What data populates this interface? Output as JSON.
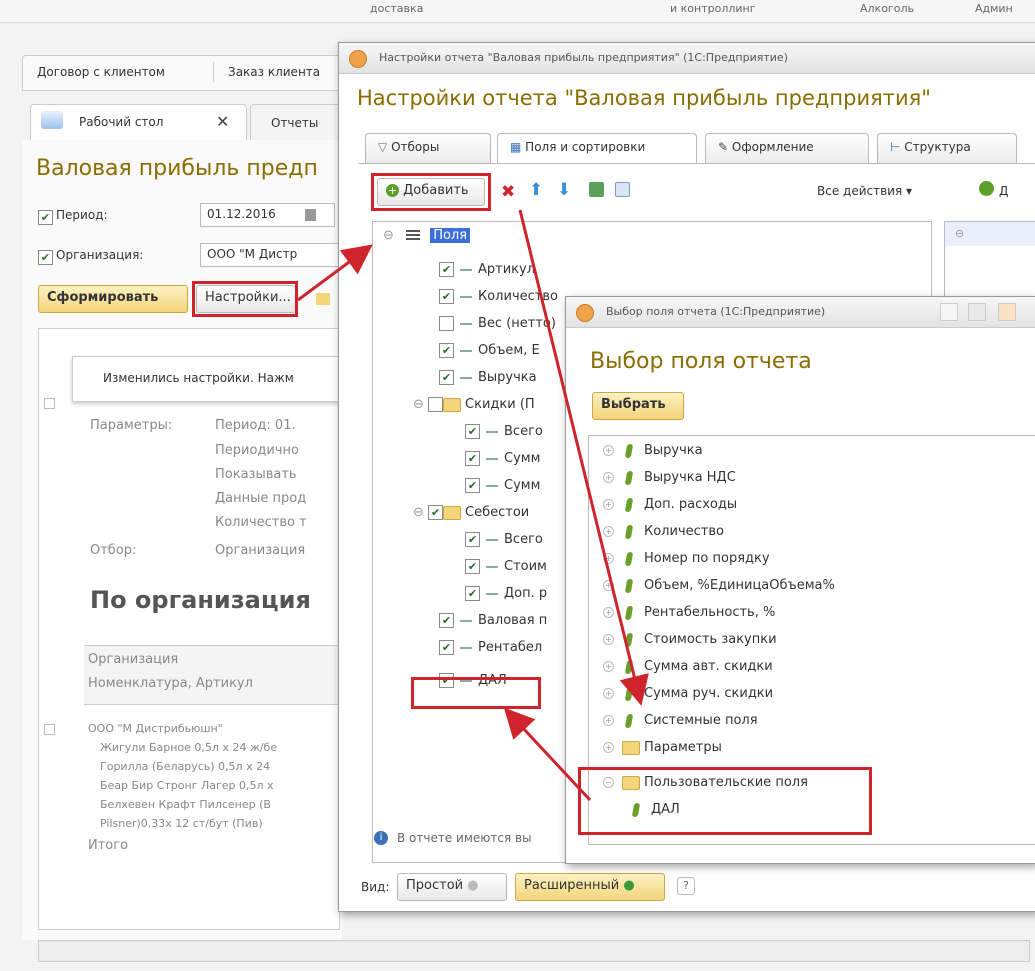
{
  "background_app": {
    "top_fragments": [
      "доставка",
      "и контроллинг",
      "Алкоголь",
      "Админ"
    ],
    "top_tabs": [
      "Договор с клиентом",
      "Заказ клиента"
    ],
    "desk_tabs": [
      {
        "label": "Рабочий стол"
      },
      {
        "label": "Отчеты"
      }
    ],
    "report_title": "Валовая прибыль предп",
    "period_label": "Период:",
    "period_value": "01.12.2016",
    "org_label": "Организация:",
    "org_value": "ООО \"М Дистр",
    "generate_btn": "Сформировать",
    "settings_btn": "Настройки...",
    "notice": "Изменились настройки. Нажм",
    "params_label": "Параметры:",
    "params_lines": [
      "Период: 01.",
      "Периодично",
      "Показывать",
      "Данные прод",
      "Количество т"
    ],
    "filter_label": "Отбор:",
    "filter_value": "Организация",
    "section_title": "По организация",
    "col1": "Организация",
    "col2": "Номенклатура, Артикул",
    "rows": [
      "ООО \"М Дистрибьюшн\"",
      "Жигули Барное 0,5л х 24 ж/бе",
      "Горилла (Беларусь) 0,5л х 24",
      "Беар Бир Стронг Лагер 0,5л х",
      "Белхевен Крафт Пилсенер (В",
      "Pilsner)0,33х 12 ст/бут (Пив)",
      "Итого"
    ]
  },
  "settings_window": {
    "window_title": "Настройки отчета \"Валовая прибыль предприятия\" (1С:Предприятие)",
    "title": "Настройки отчета \"Валовая прибыль предприятия\"",
    "tabs": [
      {
        "label": "Отборы"
      },
      {
        "label": "Поля и сортировки"
      },
      {
        "label": "Оформление"
      },
      {
        "label": "Структура"
      }
    ],
    "add_btn": "Добавить",
    "all_actions": "Все действия ▾",
    "right_add": "Д",
    "root_label": "Поля",
    "fields": [
      {
        "label": "Артикул",
        "checked": true
      },
      {
        "label": "Количество",
        "checked": true
      },
      {
        "label": "Вес (нетто)",
        "checked": false
      },
      {
        "label": "Объем, Е",
        "checked": true
      },
      {
        "label": "Выручка",
        "checked": true
      },
      {
        "label": "Скидки (П",
        "checked": false,
        "folder": true
      },
      {
        "label": "Всего",
        "checked": true,
        "indent": true
      },
      {
        "label": "Сумм",
        "checked": true,
        "indent": true
      },
      {
        "label": "Сумм",
        "checked": true,
        "indent": true
      },
      {
        "label": "Себестои",
        "checked": true,
        "folder": true
      },
      {
        "label": "Всего",
        "checked": true,
        "indent": true
      },
      {
        "label": "Стоим",
        "checked": true,
        "indent": true
      },
      {
        "label": "Доп. р",
        "checked": true,
        "indent": true
      },
      {
        "label": "Валовая п",
        "checked": true
      },
      {
        "label": "Рентабел",
        "checked": true
      },
      {
        "label": "ДАЛ",
        "checked": true
      }
    ],
    "info_text": "В отчете имеются вы",
    "view_label": "Вид:",
    "view_simple": "Простой",
    "view_extended": "Расширенный"
  },
  "select_window": {
    "window_title": "Выбор поля отчета (1С:Предприятие)",
    "title": "Выбор поля отчета",
    "select_btn": "Выбрать",
    "items": [
      {
        "label": "Выручка",
        "folder": false
      },
      {
        "label": "Выручка НДС",
        "folder": false
      },
      {
        "label": "Доп. расходы",
        "folder": false
      },
      {
        "label": "Количество",
        "folder": false
      },
      {
        "label": "Номер по порядку",
        "folder": false
      },
      {
        "label": "Объем, %ЕдиницаОбъема%",
        "folder": false
      },
      {
        "label": "Рентабельность, %",
        "folder": false
      },
      {
        "label": "Стоимость закупки",
        "folder": false
      },
      {
        "label": "Сумма авт. скидки",
        "folder": false
      },
      {
        "label": "Сумма руч. скидки",
        "folder": false
      },
      {
        "label": "Системные поля",
        "folder": false
      },
      {
        "label": "Параметры",
        "folder": true
      },
      {
        "label": "Пользовательские поля",
        "folder": true
      },
      {
        "label": "ДАЛ",
        "folder": false,
        "child": true
      }
    ]
  },
  "colors": {
    "accent_red": "#d0242c",
    "title_yellow": "#8a6d00"
  }
}
